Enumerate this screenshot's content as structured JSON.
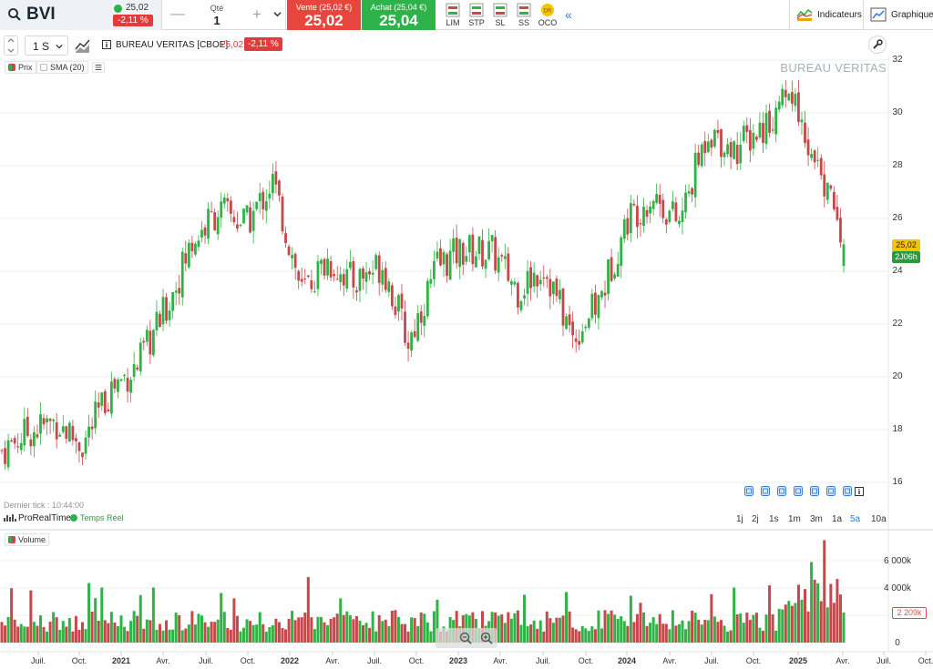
{
  "symbol": {
    "name": "BVI",
    "price": "25,02",
    "change": "-2,11 %"
  },
  "quantity": {
    "label": "Qté",
    "value": "1"
  },
  "sell": {
    "label": "Vente (25,02 €)",
    "value": "25,02"
  },
  "buy": {
    "label": "Achat (25,04 €)",
    "value": "25,04"
  },
  "order_types": [
    "LIM",
    "STP",
    "SL",
    "SS",
    "OCO"
  ],
  "toolbar": {
    "indicators": "Indicateurs",
    "chart": "Graphique"
  },
  "chart_toolbar": {
    "timeframe": "1 S",
    "instrument": "BUREAU VERITAS [CBOE]",
    "price": "25,02",
    "change": "-2,11 %"
  },
  "legend": {
    "price": "Prix",
    "sma": "SMA (20)",
    "volume": "Volume"
  },
  "watermark": "BUREAU VERITAS",
  "last_tick": "Dernier tick : 10:44:00",
  "provider": {
    "name": "ProRealTime",
    "status": "Temps Réel"
  },
  "badges": {
    "price": "25,02",
    "countdown": "2J06h",
    "volume": "2 209k"
  },
  "ranges": [
    "1j",
    "2j",
    "1s",
    "1m",
    "3m",
    "1a",
    "5a",
    "10a"
  ],
  "active_range": "5a",
  "colors": {
    "up": "#2fb344",
    "down": "#c9464a",
    "sell": "#e8453c",
    "buy": "#2db34a",
    "price_badge": "#f5c400",
    "countdown_badge": "#2b9a3c"
  },
  "chart_data": {
    "type": "candlestick",
    "title": "BUREAU VERITAS",
    "x_ticks": [
      "Juil.",
      "Oct.",
      "2021",
      "Avr.",
      "Juil.",
      "Oct.",
      "2022",
      "Avr.",
      "Juil.",
      "Oct.",
      "2023",
      "Avr.",
      "Juil.",
      "Oct.",
      "2024",
      "Avr.",
      "Juil.",
      "Oct.",
      "2025",
      "Avr.",
      "Juil.",
      "Oct."
    ],
    "price_axis": {
      "ticks": [
        16,
        18,
        20,
        22,
        24,
        26,
        28,
        30,
        32
      ],
      "range": [
        15.6,
        32.2
      ]
    },
    "volume_axis": {
      "ticks": [
        "0",
        "2 000k",
        "4 000k",
        "6 000k"
      ],
      "range": [
        0,
        7200
      ]
    },
    "close_series": [
      {
        "x": "2020-04",
        "close": 17.2
      },
      {
        "x": "2020-06",
        "close": 17.9
      },
      {
        "x": "2020-08",
        "close": 18.3
      },
      {
        "x": "2020-10",
        "close": 17.4
      },
      {
        "x": "2020-12",
        "close": 19.6
      },
      {
        "x": "2021-02",
        "close": 20.4
      },
      {
        "x": "2021-04",
        "close": 22.6
      },
      {
        "x": "2021-06",
        "close": 25.1
      },
      {
        "x": "2021-08",
        "close": 26.3
      },
      {
        "x": "2021-10",
        "close": 25.8
      },
      {
        "x": "2021-12",
        "close": 27.4
      },
      {
        "x": "2022-02",
        "close": 23.2
      },
      {
        "x": "2022-04",
        "close": 24.4
      },
      {
        "x": "2022-06",
        "close": 23.6
      },
      {
        "x": "2022-08",
        "close": 24.3
      },
      {
        "x": "2022-10",
        "close": 21.3
      },
      {
        "x": "2022-12",
        "close": 24.2
      },
      {
        "x": "2023-02",
        "close": 24.8
      },
      {
        "x": "2023-04",
        "close": 24.7
      },
      {
        "x": "2023-06",
        "close": 23.3
      },
      {
        "x": "2023-08",
        "close": 24.2
      },
      {
        "x": "2023-10",
        "close": 21.5
      },
      {
        "x": "2023-12",
        "close": 22.8
      },
      {
        "x": "2024-02",
        "close": 26.0
      },
      {
        "x": "2024-04",
        "close": 26.9
      },
      {
        "x": "2024-06",
        "close": 25.8
      },
      {
        "x": "2024-08",
        "close": 29.4
      },
      {
        "x": "2024-10",
        "close": 28.6
      },
      {
        "x": "2024-12",
        "close": 29.5
      },
      {
        "x": "2025-02",
        "close": 30.6
      },
      {
        "x": "2025-03",
        "close": 28.0
      },
      {
        "x": "2025-04",
        "close": 25.02
      }
    ],
    "volume": "Weekly volume bars, mostly 1 000k–2 500k, peaks near 7 500k in early 2025"
  }
}
